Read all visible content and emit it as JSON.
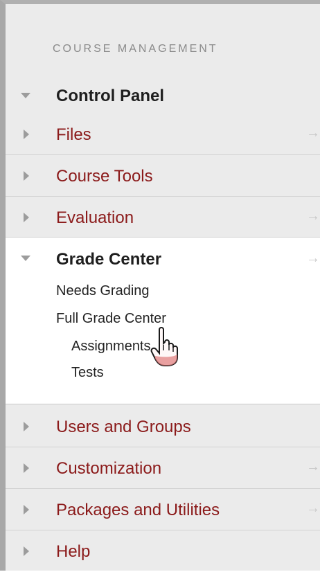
{
  "menu": {
    "heading": "COURSE MANAGEMENT",
    "control_panel": "Control Panel",
    "items_top": [
      {
        "label": "Files"
      },
      {
        "label": "Course Tools"
      },
      {
        "label": "Evaluation"
      }
    ],
    "grade_center": {
      "label": "Grade Center",
      "children": [
        {
          "label": "Needs Grading"
        },
        {
          "label": "Full Grade Center"
        },
        {
          "label": "Assignments"
        },
        {
          "label": "Tests"
        }
      ]
    },
    "items_bottom": [
      {
        "label": "Users and Groups"
      },
      {
        "label": "Customization"
      },
      {
        "label": "Packages and Utilities"
      },
      {
        "label": "Help"
      }
    ],
    "arrow_glyph": "→",
    "icons": {
      "collapsed": "triangle-right-icon",
      "expanded": "triangle-down-icon",
      "pointer": "hand-pointer-icon"
    },
    "colors": {
      "link": "#8b1a1a",
      "panel_bg": "#ebebeb",
      "expanded_bg": "#ffffff"
    }
  }
}
